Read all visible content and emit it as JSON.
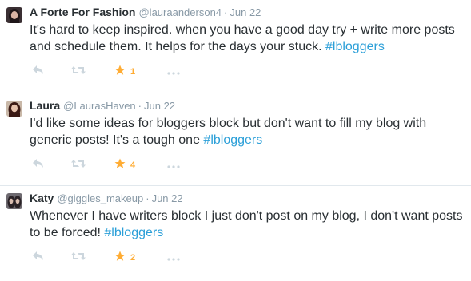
{
  "tweets": [
    {
      "fullname": "A Forte For Fashion",
      "username": "@lauraanderson4",
      "separator": "·",
      "time": "Jun 22",
      "text_lines": [
        "It's hard to keep inspired. when you have a good day try + write more posts",
        "and schedule them. It helps for the days your stuck. "
      ],
      "hashtag": "#lbloggers",
      "favorite_count": "1",
      "avatar_colors": {
        "bg": "#3a2f33",
        "face": "#d9b4a4",
        "hair": "#1f1719"
      }
    },
    {
      "fullname": "Laura",
      "username": "@LaurasHaven",
      "separator": "·",
      "time": "Jun 22",
      "text_lines": [
        "I'd like some ideas for bloggers block but don't want to fill my blog with",
        "generic posts! It's a tough one "
      ],
      "hashtag": "#lbloggers",
      "favorite_count": "4",
      "avatar_colors": {
        "bg": "#c9b8a8",
        "face": "#e6c3ad",
        "hair": "#3b1a14"
      }
    },
    {
      "fullname": "Katy",
      "username": "@giggles_makeup",
      "separator": "·",
      "time": "Jun 22",
      "text_lines": [
        "Whenever I have writers block I just don't post on my blog, I don't want posts",
        "to be forced! "
      ],
      "hashtag": "#lbloggers",
      "favorite_count": "2",
      "avatar_colors": {
        "bg": "#6e6a70",
        "face": "#d9bdb0",
        "hair": "#2a2226"
      }
    }
  ],
  "icons": {
    "reply": "reply-icon",
    "retweet": "retweet-icon",
    "favorite": "star-icon",
    "more": "more-dots-icon"
  },
  "colors": {
    "hashtag": "#2b9fd8",
    "action_icon": "#ccd6dd",
    "favorite_active": "#ffac33",
    "meta": "#8899a6",
    "divider": "#e1e8ed"
  }
}
